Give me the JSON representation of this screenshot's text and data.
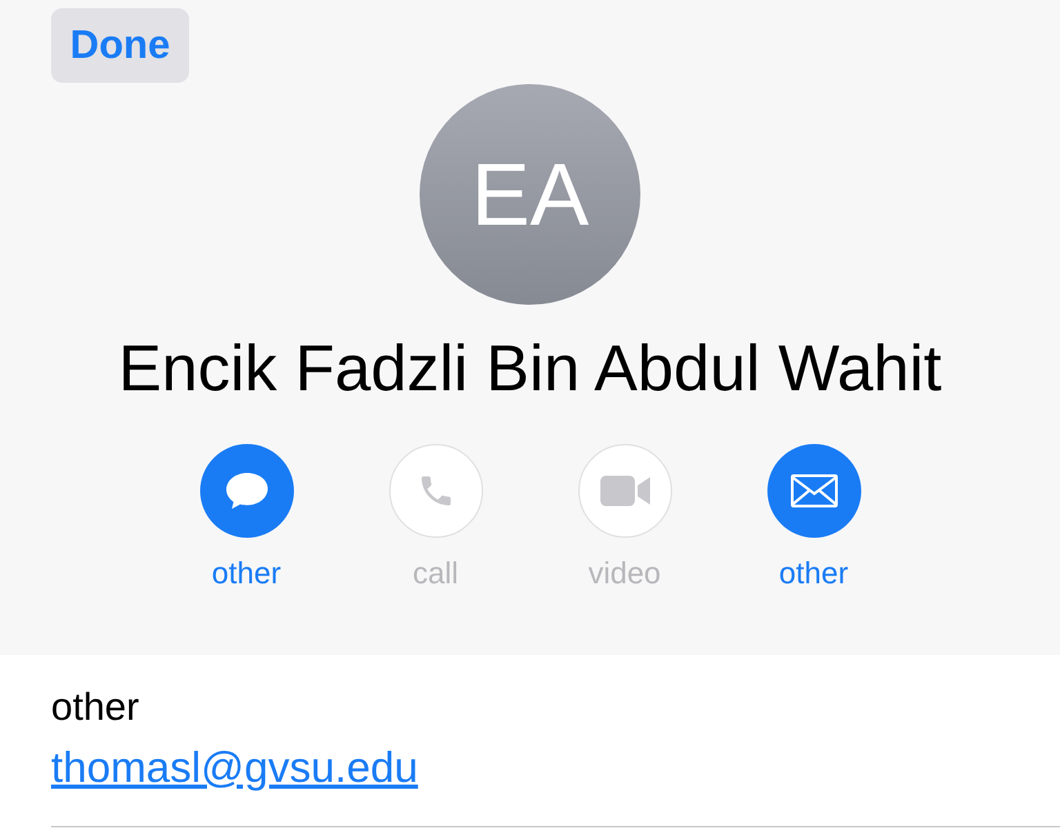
{
  "nav": {
    "done_button": "Done"
  },
  "contact": {
    "initials": "EA",
    "name": "Encik Fadzli Bin Abdul Wahit"
  },
  "actions": [
    {
      "kind": "message",
      "label": "other",
      "disabled": false
    },
    {
      "kind": "call",
      "label": "call",
      "disabled": true
    },
    {
      "kind": "video",
      "label": "video",
      "disabled": true
    },
    {
      "kind": "mail",
      "label": "other",
      "disabled": false
    }
  ],
  "fields": [
    {
      "label": "other",
      "value": "thomasl@gvsu.edu"
    }
  ]
}
